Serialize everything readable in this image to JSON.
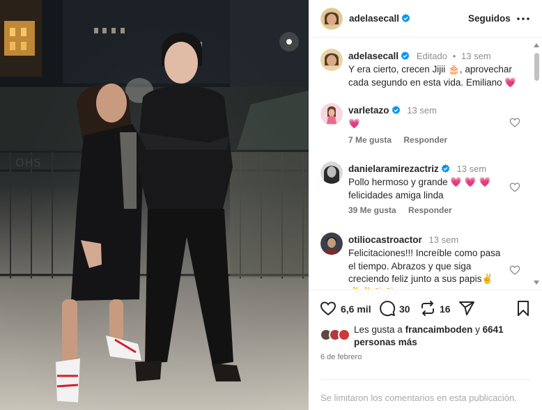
{
  "post": {
    "author": "adelasecall",
    "follow_state": "Seguidos",
    "caption": {
      "username": "adelasecall",
      "edited": "Editado",
      "dot": "•",
      "age": "13 sem",
      "text": "Y era cierto, crecen Jijii 🎂, aprovechar cada segundo en esta vida. Emiliano 💗"
    },
    "photo": {
      "watermark": "OHS"
    }
  },
  "comments": [
    {
      "username": "varletazo",
      "age": "13 sem",
      "text": "💗",
      "likes": "7 Me gusta",
      "reply": "Responder"
    },
    {
      "username": "danielaramirezactriz",
      "age": "13 sem",
      "text": "Pollo hermoso y grande 💗 💗 💗 felicidades amiga linda",
      "likes": "39 Me gusta",
      "reply": "Responder"
    },
    {
      "username": "otiliocastroactor",
      "age": "13 sem",
      "text": "Felicitaciones!!! Increíble como pasa el tiempo. Abrazos y que siga creciendo feliz junto a sus papis✌️ ✌️✌️👏👏",
      "likes": "",
      "reply": ""
    }
  ],
  "actions": {
    "likes": "6,6 mil",
    "comments": "30",
    "reposts": "16"
  },
  "liked_by": {
    "prefix": "Les gusta a",
    "user": "francaimboden",
    "connector": "y",
    "count": "6641",
    "suffix": "personas más"
  },
  "date": "6 de febrero",
  "comments_limited": "Se limitaron los comentarios en esta publicación.",
  "colors": {
    "verified": "#0095f6",
    "text": "#262626",
    "secondary": "#737373",
    "heart": "#ff3b6b"
  }
}
